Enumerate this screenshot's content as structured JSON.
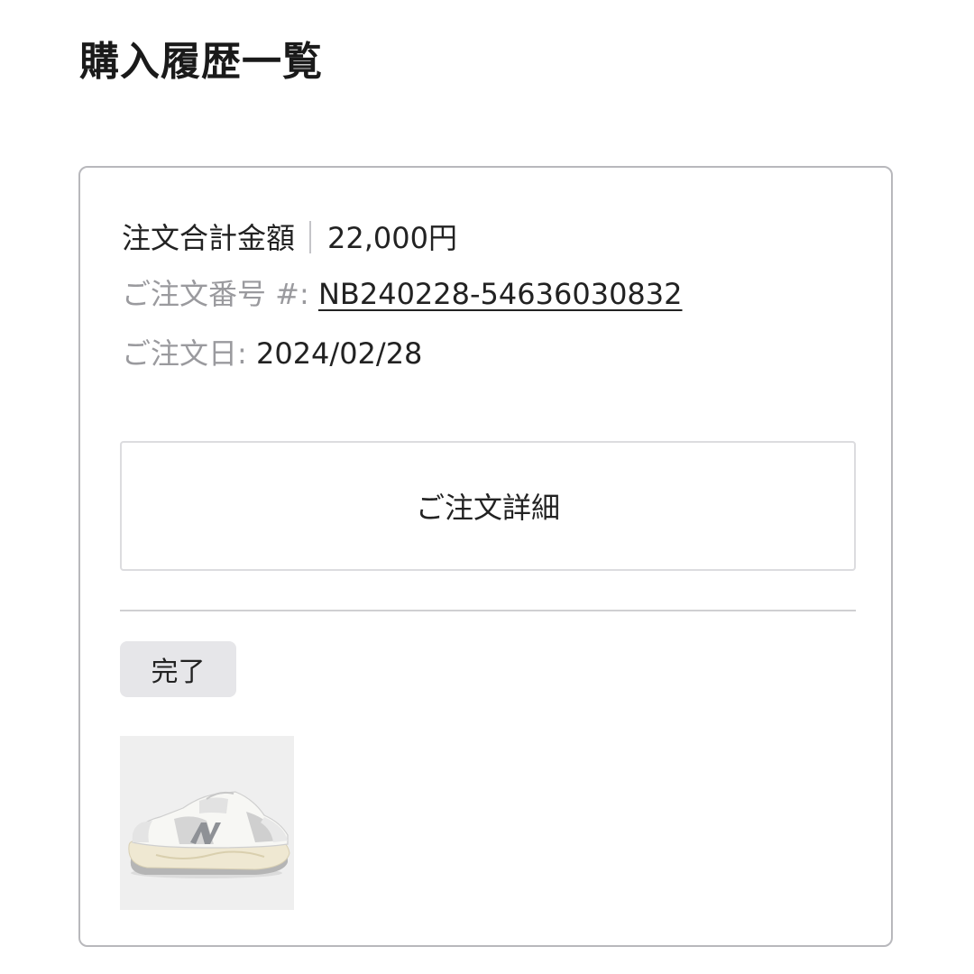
{
  "page": {
    "title": "購入履歴一覧"
  },
  "order": {
    "total_label": "注文合計金額",
    "total_value": "22,000円",
    "number_label": "ご注文番号 #:",
    "number_value": "NB240228-54636030832",
    "date_label": "ご注文日:",
    "date_value": "2024/02/28",
    "detail_button_label": "ご注文詳細",
    "status": "完了",
    "product_image": "sneaker-thumbnail"
  }
}
